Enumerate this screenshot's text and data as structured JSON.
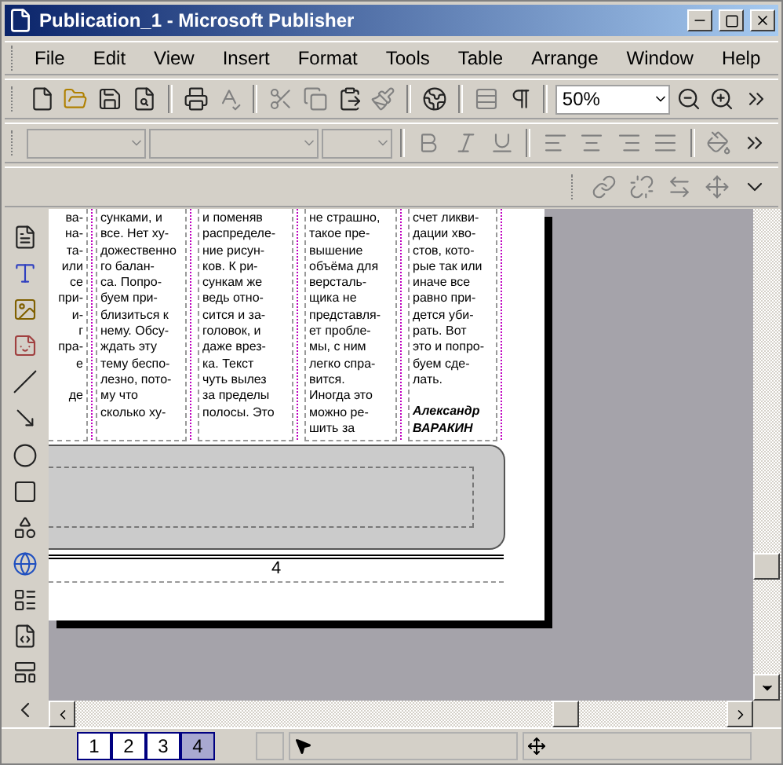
{
  "window": {
    "title": "Publication_1 - Microsoft Publisher"
  },
  "menu": [
    {
      "label": "File"
    },
    {
      "label": "Edit"
    },
    {
      "label": "View"
    },
    {
      "label": "Insert"
    },
    {
      "label": "Format"
    },
    {
      "label": "Tools"
    },
    {
      "label": "Table"
    },
    {
      "label": "Arrange"
    },
    {
      "label": "Window"
    },
    {
      "label": "Help"
    }
  ],
  "standard_toolbar": {
    "zoom": "50%"
  },
  "page": {
    "columns": [
      {
        "paragraphs": [
          [
            "ва-",
            "на-",
            "та-",
            "или",
            "се",
            "при-",
            "и-",
            "г",
            "пра-",
            "е"
          ],
          [
            "де"
          ]
        ]
      },
      {
        "paragraphs": [
          [
            "сунками, и",
            "все. Нет ху-",
            "дожественно",
            "го балан-",
            "са. Попро-",
            "буем при-",
            "близиться к",
            "нему. Обсу-",
            "ждать эту",
            "тему беспо-",
            "лезно, пото-",
            "му что",
            "сколько ху-"
          ]
        ]
      },
      {
        "paragraphs": [
          [
            "и поменяв",
            "распределе-",
            "ние рисун-",
            "ков. К ри-",
            "сункам же",
            "ведь отно-",
            "сится и за-",
            "головок, и",
            "даже врез-",
            "ка. Текст",
            "чуть вылез",
            "за пределы",
            "полосы. Это"
          ]
        ]
      },
      {
        "paragraphs": [
          [
            "не страшно,",
            "такое пре-",
            "вышение",
            "объёма для",
            "версталь-",
            "щика не",
            "представля-",
            "ет пробле-",
            "мы, с ним",
            "легко спра-",
            "вится.",
            "Иногда это",
            "можно ре-",
            "шить за"
          ]
        ]
      },
      {
        "paragraphs": [
          [
            "счет ликви-",
            "дации хво-",
            "стов, кото-",
            "рые так или",
            "иначе все",
            "равно при-",
            "дется уби-",
            "рать. Вот",
            "это и попро-",
            "буем сде-",
            "лать."
          ]
        ],
        "signature": [
          "Александр",
          "ВАРАКИН"
        ]
      }
    ],
    "page_number": "4"
  },
  "page_tabs": [
    {
      "label": "1",
      "selected": false
    },
    {
      "label": "2",
      "selected": false
    },
    {
      "label": "3",
      "selected": false
    },
    {
      "label": "4",
      "selected": true
    }
  ]
}
